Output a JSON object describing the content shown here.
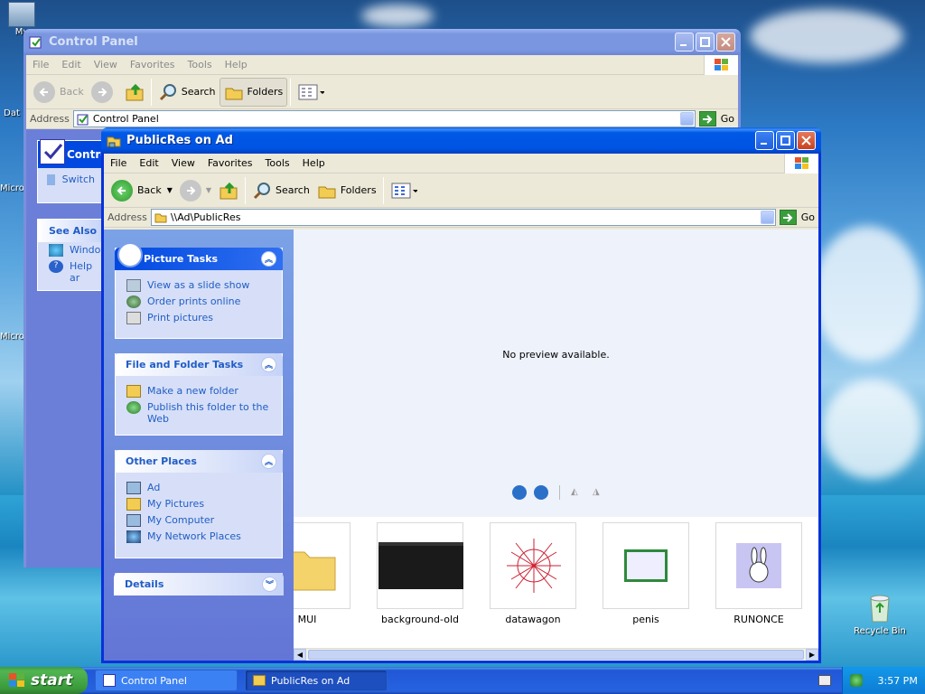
{
  "desktop": {
    "icons": [
      "My",
      "Dat",
      "Micro",
      "Micro",
      "Recycle Bin"
    ],
    "recycle_bin": "Recycle Bin"
  },
  "control_panel": {
    "title": "Control Panel",
    "menu": [
      "File",
      "Edit",
      "View",
      "Favorites",
      "Tools",
      "Help"
    ],
    "toolbar": {
      "back": "Back",
      "search": "Search",
      "folders": "Folders"
    },
    "address_label": "Address",
    "address": "Control Panel",
    "go": "Go",
    "pane_title": "Contro",
    "switch": "Switch",
    "see_also": "See Also",
    "see_also_items": [
      "Window",
      "Help ar"
    ]
  },
  "publicres": {
    "title": "PublicRes on Ad",
    "menu": [
      "File",
      "Edit",
      "View",
      "Favorites",
      "Tools",
      "Help"
    ],
    "toolbar": {
      "back": "Back",
      "search": "Search",
      "folders": "Folders"
    },
    "address_label": "Address",
    "address": "\\\\Ad\\PublicRes",
    "go": "Go",
    "picture_tasks": {
      "title": "Picture Tasks",
      "items": [
        "View as a slide show",
        "Order prints online",
        "Print pictures"
      ]
    },
    "file_tasks": {
      "title": "File and Folder Tasks",
      "items": [
        "Make a new folder",
        "Publish this folder to the",
        "Web"
      ]
    },
    "other_places": {
      "title": "Other Places",
      "items": [
        "Ad",
        "My Pictures",
        "My Computer",
        "My Network Places"
      ]
    },
    "details": {
      "title": "Details"
    },
    "preview_text": "No preview available.",
    "files": [
      "MUI",
      "background-old",
      "datawagon",
      "penis",
      "RUNONCE"
    ]
  },
  "taskbar": {
    "start": "start",
    "items": [
      "Control Panel",
      "PublicRes on Ad"
    ],
    "clock": "3:57 PM"
  }
}
